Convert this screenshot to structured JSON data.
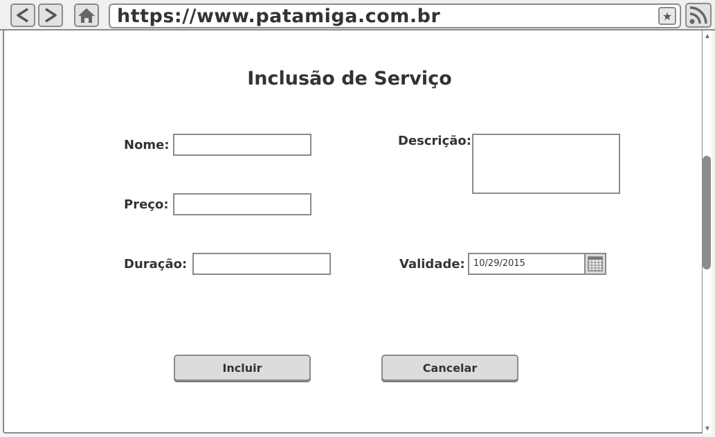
{
  "browser": {
    "url": "https://www.patamiga.com.br",
    "icons": {
      "back": "back-arrow-icon",
      "forward": "forward-arrow-icon",
      "home": "home-icon",
      "bookmark": "star-icon",
      "rss": "rss-icon",
      "calendar": "calendar-icon"
    }
  },
  "form": {
    "title": "Inclusão de Serviço",
    "nome_label": "Nome:",
    "nome_value": "",
    "preco_label": "Preço:",
    "preco_value": "",
    "duracao_label": "Duração:",
    "duracao_value": "",
    "descricao_label": "Descrição:",
    "descricao_value": "",
    "validade_label": "Validade:",
    "validade_value": "10/29/2015"
  },
  "actions": {
    "incluir_label": "Incluir",
    "cancelar_label": "Cancelar"
  },
  "colors": {
    "border": "#8a8a8a",
    "button_bg": "#dcdcdc",
    "text": "#333333",
    "scroll_thumb": "#8c8c8c"
  }
}
